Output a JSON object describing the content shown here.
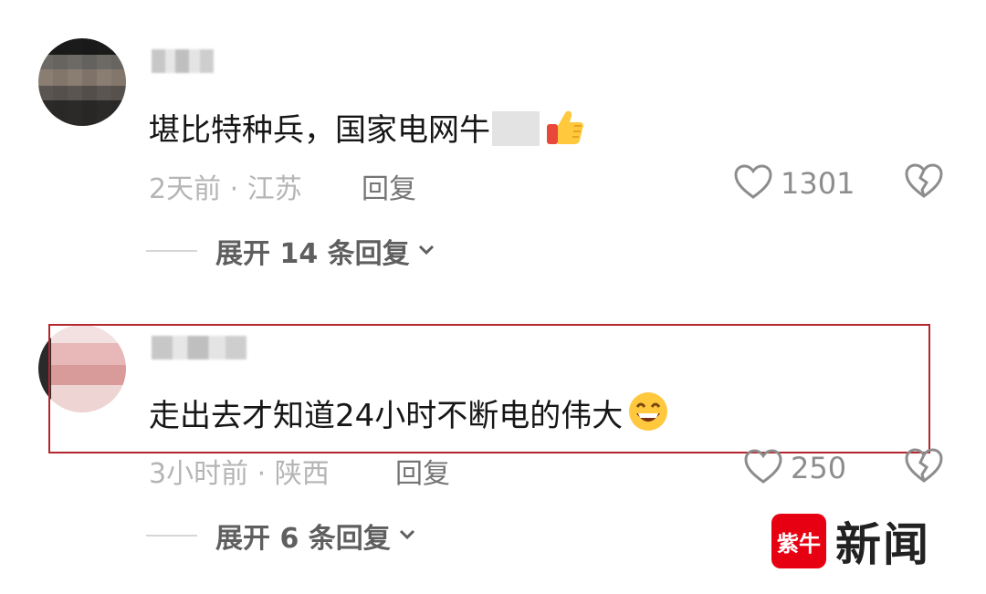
{
  "comments": [
    {
      "text": "堪比特种兵，国家电网牛",
      "emoji": "thumbs-up",
      "time": "2天前",
      "sep": "·",
      "location": "江苏",
      "reply_label": "回复",
      "likes": "1301",
      "expand_label": "展开 14 条回复"
    },
    {
      "text": "走出去才知道24小时不断电的伟大",
      "emoji": "grinning-face",
      "time": "3小时前",
      "sep": "·",
      "location": "陕西",
      "reply_label": "回复",
      "likes": "250",
      "expand_label": "展开 6 条回复"
    }
  ],
  "watermark": {
    "logo_text": "紫牛",
    "text": "新闻",
    "brand_color": "#e60012"
  },
  "highlight_color": "#b5262f"
}
